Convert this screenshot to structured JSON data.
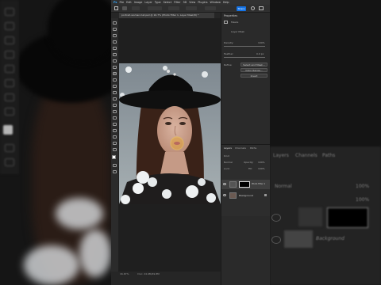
{
  "app": {
    "menu": [
      "Ps",
      "File",
      "Edit",
      "Image",
      "Layer",
      "Type",
      "Select",
      "Filter",
      "3D",
      "View",
      "Plugins",
      "Window",
      "Help"
    ],
    "share_label": "Share",
    "document_tab": "portrait-woman-hat.psd @ 16.7% (Photo Filter 1, Layer Mask/8) *",
    "status": "16.67%",
    "status_doc": "Doc: 24.9M/49.8M"
  },
  "properties": {
    "title": "Properties",
    "section": "Masks",
    "mask_label": "Layer Mask",
    "density_label": "Density:",
    "density_value": "100%",
    "feather_label": "Feather:",
    "feather_value": "0.0 px",
    "refine_label": "Refine:",
    "buttons": [
      "Select and Mask...",
      "Color Range...",
      "Invert"
    ]
  },
  "layers": {
    "tabs": [
      "Layers",
      "Channels",
      "Paths"
    ],
    "kind_label": "Kind",
    "blend_mode": "Normal",
    "opacity_label": "Opacity:",
    "opacity_value": "100%",
    "lock_label": "Lock:",
    "fill_label": "Fill:",
    "fill_value": "100%",
    "items": [
      {
        "name": "Photo Filter 1"
      },
      {
        "name": "Background"
      }
    ]
  },
  "background": {
    "left_labels": [
      "Layers",
      "Channels",
      "Paths"
    ],
    "right_tabs": [
      "Layers",
      "Channels",
      "Paths"
    ],
    "right_layer": "Background",
    "right_blend": "Normal",
    "right_opacity": "100%",
    "right_fill": "100%"
  },
  "colors": {
    "accent": "#1473e6",
    "app_bg": "#262626",
    "panel_bg": "#2a2a2a"
  }
}
